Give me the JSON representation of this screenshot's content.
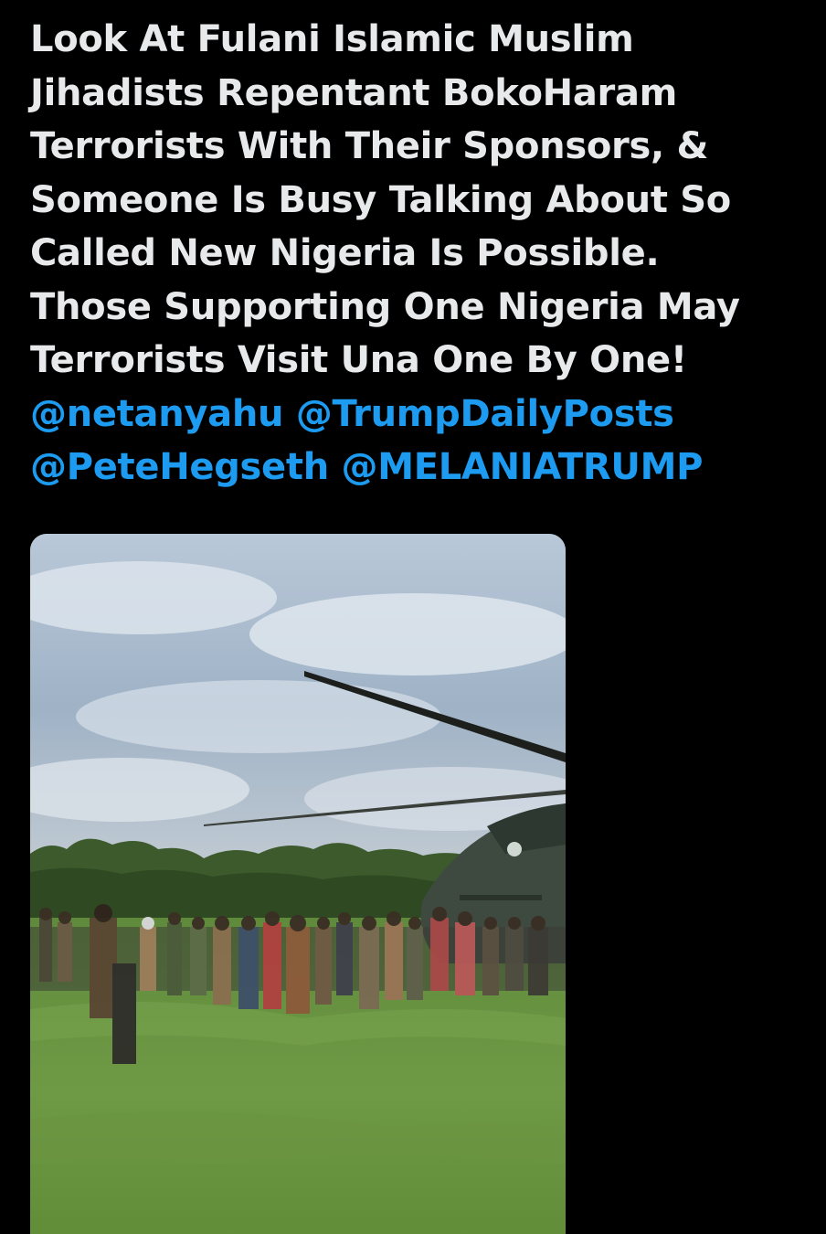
{
  "post": {
    "text_lines": [
      "Look At Fulani Islamic Muslim",
      "Jihadists Repentant BokoHaram",
      "Terrorists With Their Sponsors, &",
      "Someone Is Busy Talking About So",
      "Called New Nigeria Is Possible.",
      "Those Supporting One Nigeria May",
      "Terrorists Visit Una One By One!"
    ],
    "mentions": [
      "@netanyahu",
      "@TrumpDailyPosts",
      "@PeteHegseth",
      "@MELANIATRUMP"
    ]
  },
  "media": {
    "type": "video-thumbnail"
  },
  "colors": {
    "background": "#000000",
    "text": "#e7e9ea",
    "mention": "#1d9bf0"
  }
}
